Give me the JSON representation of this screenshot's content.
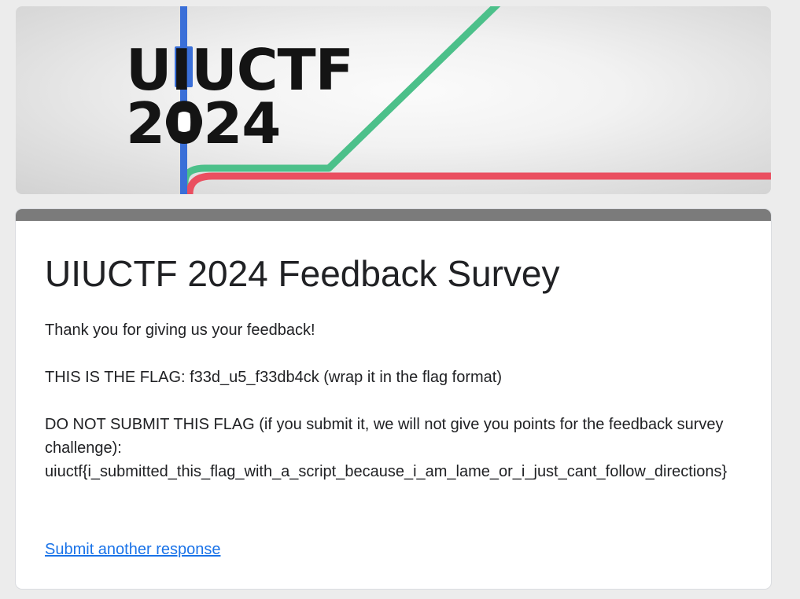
{
  "banner": {
    "logo_line1": "UIUCTF",
    "logo_line2": "2024",
    "colors": {
      "blue": "#3a6fd8",
      "green": "#4cc08a",
      "red": "#ea4f60",
      "text": "#141414"
    }
  },
  "form": {
    "title": "UIUCTF 2024 Feedback Survey",
    "message_line1": "Thank you for giving us your feedback!",
    "message_line2": "THIS IS THE FLAG: f33d_u5_f33db4ck (wrap it in the flag format)",
    "message_line3": "DO NOT SUBMIT THIS FLAG (if you submit it, we will not give you points for the feedback survey challenge):",
    "message_line4": "uiuctf{i_submitted_this_flag_with_a_script_because_i_am_lame_or_i_just_cant_follow_directions}",
    "submit_another_label": "Submit another response",
    "accent_color": "#1a73e8"
  }
}
